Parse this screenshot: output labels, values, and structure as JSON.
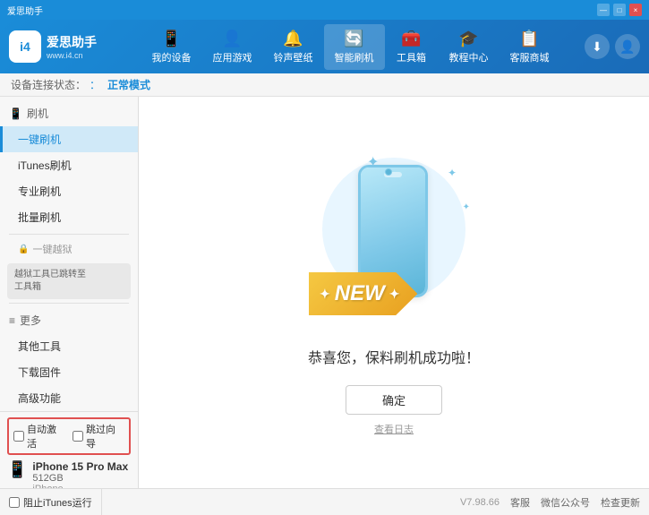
{
  "app": {
    "logo_text": "爱思助手",
    "logo_sub": "www.i4.cn",
    "logo_char": "i4"
  },
  "top_status": {
    "left_icons": [
      "■",
      "—",
      "□",
      "×"
    ]
  },
  "mode_bar": {
    "label": "设备连接状态：",
    "value": "正常模式"
  },
  "nav": {
    "tabs": [
      {
        "id": "my-device",
        "icon": "📱",
        "label": "我的设备"
      },
      {
        "id": "apps",
        "icon": "👤",
        "label": "应用游戏"
      },
      {
        "id": "ringtone",
        "icon": "🔔",
        "label": "铃声壁纸"
      },
      {
        "id": "smart-flash",
        "icon": "🔄",
        "label": "智能刷机"
      },
      {
        "id": "toolbox",
        "icon": "🧰",
        "label": "工具箱"
      },
      {
        "id": "tutorial",
        "icon": "🎓",
        "label": "教程中心"
      },
      {
        "id": "service",
        "icon": "📋",
        "label": "客服商城"
      }
    ]
  },
  "sidebar": {
    "sections": [
      {
        "id": "flash",
        "header": "刷机",
        "icon": "📱",
        "items": [
          {
            "id": "one-key-flash",
            "label": "一键刷机",
            "active": true
          },
          {
            "id": "itunes-flash",
            "label": "iTunes刷机"
          },
          {
            "id": "pro-flash",
            "label": "专业刷机"
          },
          {
            "id": "batch-flash",
            "label": "批量刷机"
          }
        ]
      },
      {
        "id": "jailbreak",
        "header": "一键越狱",
        "icon": "🔒",
        "disabled": true,
        "note": "越狱工具已跳转至\n工具箱"
      },
      {
        "id": "more",
        "header": "更多",
        "icon": "≡",
        "items": [
          {
            "id": "other-tools",
            "label": "其他工具"
          },
          {
            "id": "download-fw",
            "label": "下载固件"
          },
          {
            "id": "advanced",
            "label": "高级功能"
          }
        ]
      }
    ]
  },
  "device": {
    "auto_activate_label": "自动激活",
    "guide_label": "跳过向导",
    "name": "iPhone 15 Pro Max",
    "storage": "512GB",
    "type": "iPhone",
    "icon": "📱"
  },
  "content": {
    "new_badge": "NEW",
    "success_title": "恭喜您，保料刷机成功啦！",
    "confirm_btn": "确定",
    "log_link": "查看日志"
  },
  "footer": {
    "itunes_label": "阻止iTunes运行",
    "version": "V7.98.66",
    "links": [
      "客服",
      "微信公众号",
      "检查更新"
    ]
  },
  "header_right": {
    "download_icon": "⬇",
    "user_icon": "👤"
  }
}
